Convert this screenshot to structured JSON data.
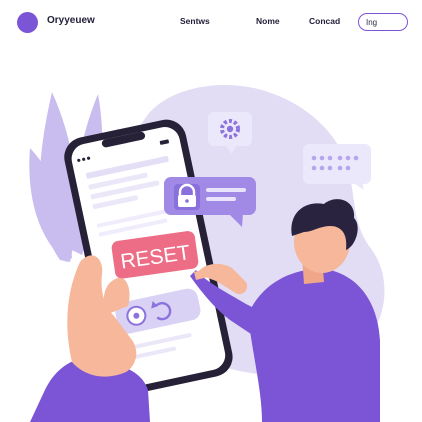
{
  "nav": {
    "brand": "Oryyeuew",
    "links": [
      "Sentws",
      "Nome",
      "Concad"
    ],
    "search_value": "Ing"
  },
  "illustration": {
    "button_label": "RESET"
  },
  "colors": {
    "accent": "#7b55d6",
    "blob": "#e2dcf5",
    "reset_button": "#ee6d86",
    "skin": "#f6b79a",
    "hair": "#2a2340"
  }
}
